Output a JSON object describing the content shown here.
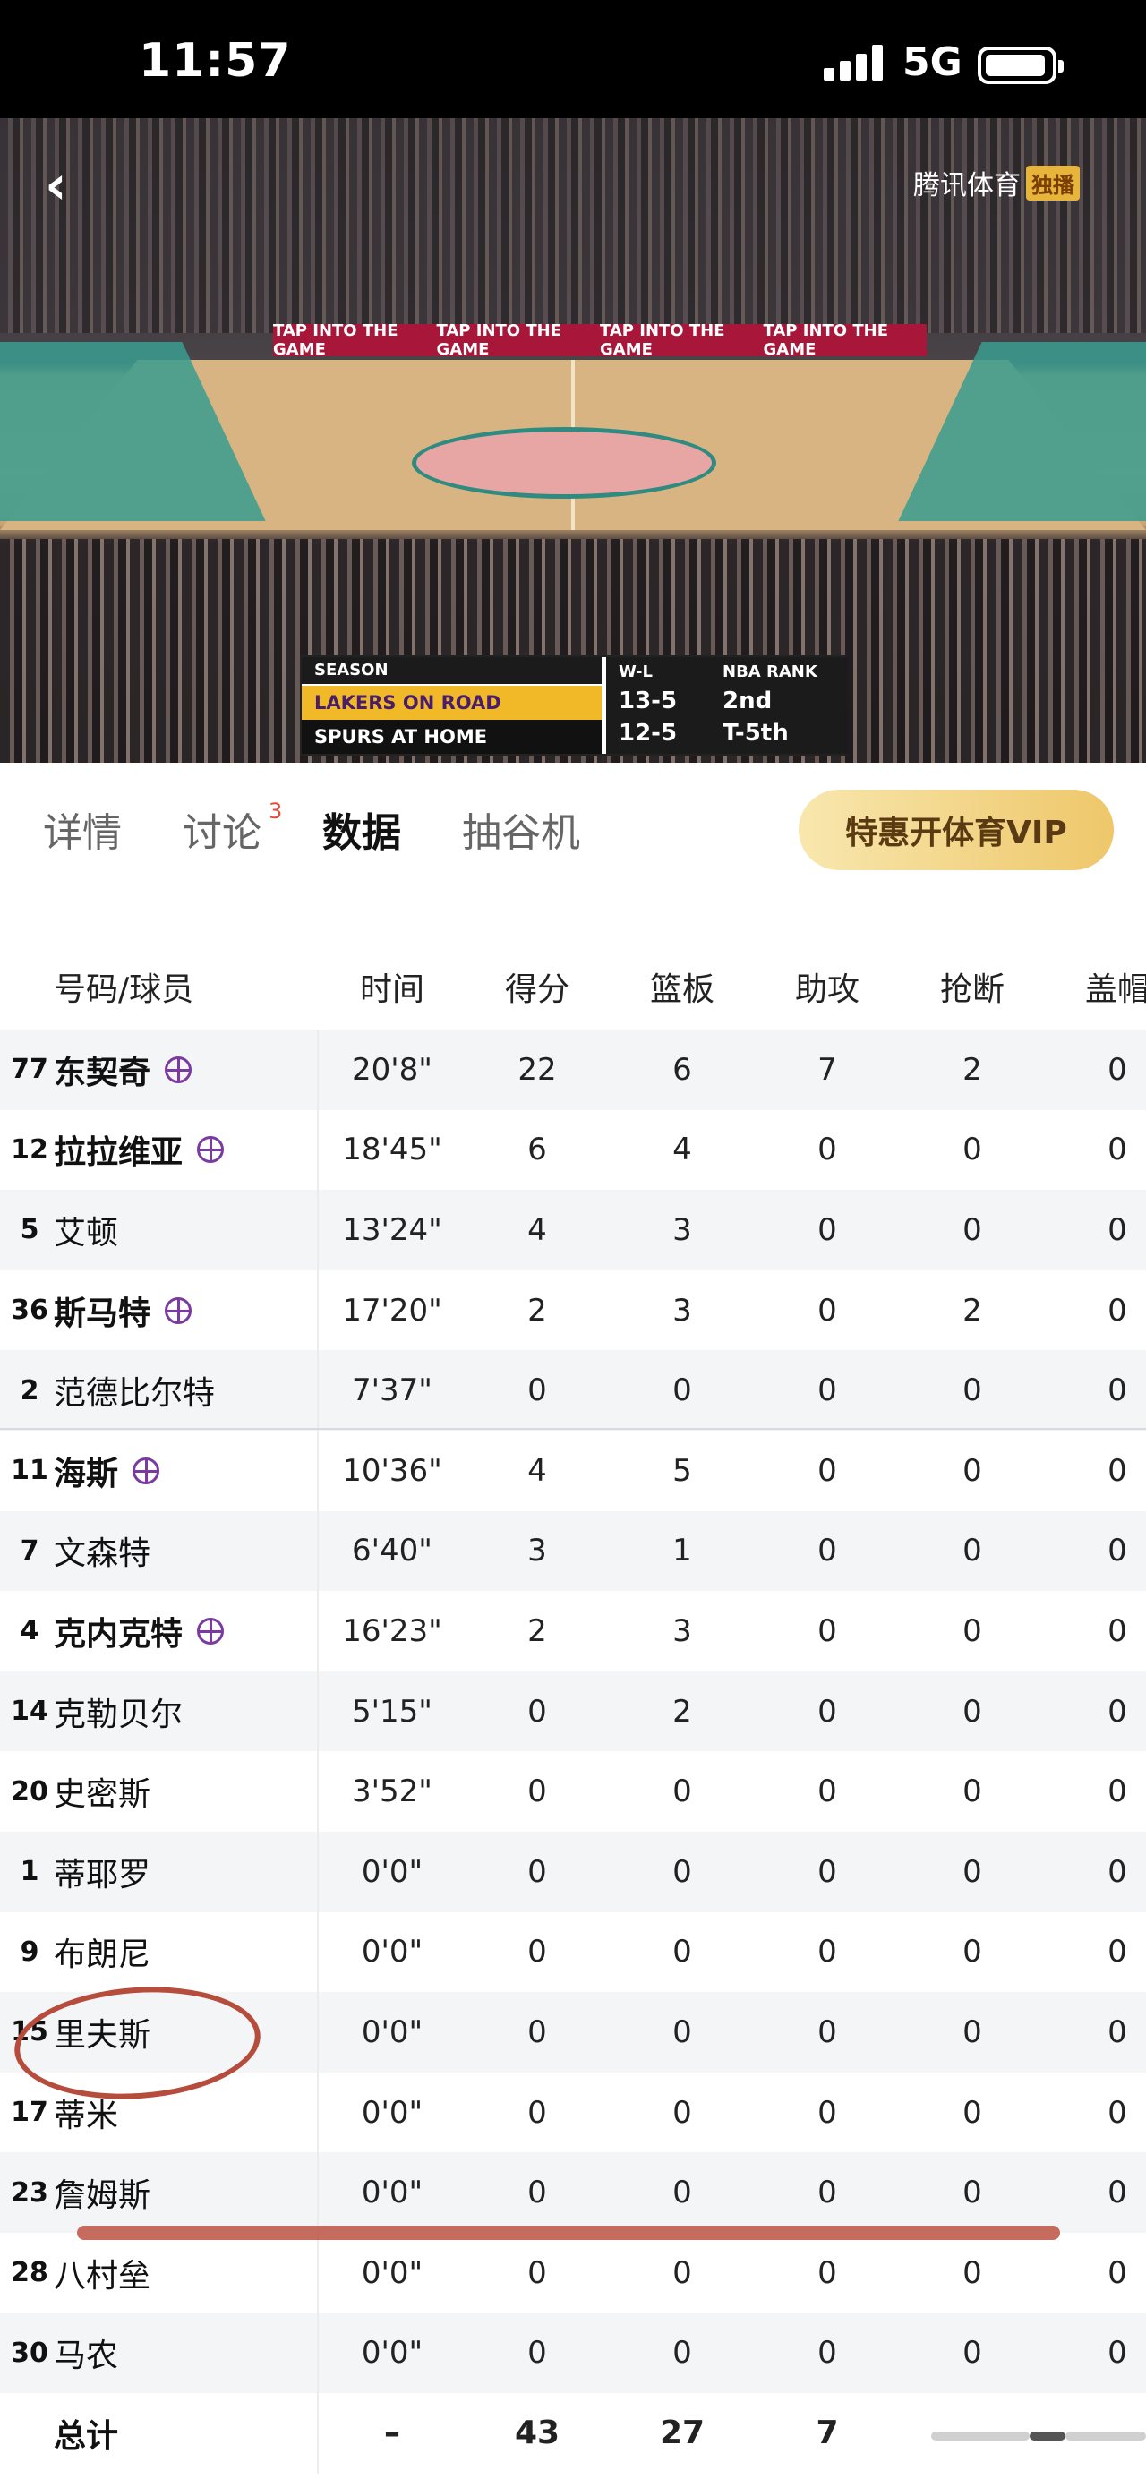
{
  "status_bar": {
    "time": "11:57",
    "network": "5G"
  },
  "video": {
    "watermark": "腾讯体育",
    "watermark_tag": "独播",
    "banner_text": [
      "TAP INTO THE GAME",
      "TAP INTO THE GAME",
      "TAP INTO THE GAME",
      "TAP INTO THE GAME"
    ],
    "scorecard": {
      "season_label": "SEASON",
      "wl_label": "W-L",
      "rank_label": "NBA RANK",
      "row1_team": "LAKERS ON ROAD",
      "row1_wl": "13-5",
      "row1_rank": "2nd",
      "row2_team": "SPURS AT HOME",
      "row2_wl": "12-5",
      "row2_rank": "T-5th"
    }
  },
  "tabs": {
    "items": [
      {
        "label": "详情"
      },
      {
        "label": "讨论",
        "badge": "3"
      },
      {
        "label": "数据"
      },
      {
        "label": "抽谷机"
      }
    ],
    "active": "数据",
    "vip_label": "特惠开体育VIP"
  },
  "table": {
    "headers": [
      "号码/球员",
      "时间",
      "得分",
      "篮板",
      "助攻",
      "抢断",
      "盖帽"
    ],
    "rows": [
      {
        "num": "77",
        "name": "东契奇",
        "starter": true,
        "time": "20'8\"",
        "pts": "22",
        "reb": "6",
        "ast": "7",
        "stl": "2",
        "blk": "0"
      },
      {
        "num": "12",
        "name": "拉拉维亚",
        "starter": true,
        "time": "18'45\"",
        "pts": "6",
        "reb": "4",
        "ast": "0",
        "stl": "0",
        "blk": "0"
      },
      {
        "num": "5",
        "name": "艾顿",
        "starter": false,
        "time": "13'24\"",
        "pts": "4",
        "reb": "3",
        "ast": "0",
        "stl": "0",
        "blk": "0"
      },
      {
        "num": "36",
        "name": "斯马特",
        "starter": true,
        "time": "17'20\"",
        "pts": "2",
        "reb": "3",
        "ast": "0",
        "stl": "2",
        "blk": "0"
      },
      {
        "num": "2",
        "name": "范德比尔特",
        "starter": false,
        "time": "7'37\"",
        "pts": "0",
        "reb": "0",
        "ast": "0",
        "stl": "0",
        "blk": "0"
      },
      {
        "num": "11",
        "name": "海斯",
        "starter": true,
        "time": "10'36\"",
        "pts": "4",
        "reb": "5",
        "ast": "0",
        "stl": "0",
        "blk": "0"
      },
      {
        "num": "7",
        "name": "文森特",
        "starter": false,
        "time": "6'40\"",
        "pts": "3",
        "reb": "1",
        "ast": "0",
        "stl": "0",
        "blk": "0"
      },
      {
        "num": "4",
        "name": "克内克特",
        "starter": true,
        "time": "16'23\"",
        "pts": "2",
        "reb": "3",
        "ast": "0",
        "stl": "0",
        "blk": "0"
      },
      {
        "num": "14",
        "name": "克勒贝尔",
        "starter": false,
        "time": "5'15\"",
        "pts": "0",
        "reb": "2",
        "ast": "0",
        "stl": "0",
        "blk": "0"
      },
      {
        "num": "20",
        "name": "史密斯",
        "starter": false,
        "time": "3'52\"",
        "pts": "0",
        "reb": "0",
        "ast": "0",
        "stl": "0",
        "blk": "0"
      },
      {
        "num": "1",
        "name": "蒂耶罗",
        "starter": false,
        "time": "0'0\"",
        "pts": "0",
        "reb": "0",
        "ast": "0",
        "stl": "0",
        "blk": "0"
      },
      {
        "num": "9",
        "name": "布朗尼",
        "starter": false,
        "time": "0'0\"",
        "pts": "0",
        "reb": "0",
        "ast": "0",
        "stl": "0",
        "blk": "0"
      },
      {
        "num": "15",
        "name": "里夫斯",
        "starter": false,
        "time": "0'0\"",
        "pts": "0",
        "reb": "0",
        "ast": "0",
        "stl": "0",
        "blk": "0"
      },
      {
        "num": "17",
        "name": "蒂米",
        "starter": false,
        "time": "0'0\"",
        "pts": "0",
        "reb": "0",
        "ast": "0",
        "stl": "0",
        "blk": "0"
      },
      {
        "num": "23",
        "name": "詹姆斯",
        "starter": false,
        "time": "0'0\"",
        "pts": "0",
        "reb": "0",
        "ast": "0",
        "stl": "0",
        "blk": "0"
      },
      {
        "num": "28",
        "name": "八村垒",
        "starter": false,
        "time": "0'0\"",
        "pts": "0",
        "reb": "0",
        "ast": "0",
        "stl": "0",
        "blk": "0"
      },
      {
        "num": "30",
        "name": "马农",
        "starter": false,
        "time": "0'0\"",
        "pts": "0",
        "reb": "0",
        "ast": "0",
        "stl": "0",
        "blk": "0"
      }
    ],
    "total": {
      "label": "总计",
      "time": "–",
      "pts": "43",
      "reb": "27",
      "ast": "7"
    }
  },
  "colors": {
    "accent_purple": "#7a3aa0",
    "vip_gold": "#eec76a",
    "annotation_red": "#b64c3c",
    "row_alt": "#f4f5f7"
  }
}
